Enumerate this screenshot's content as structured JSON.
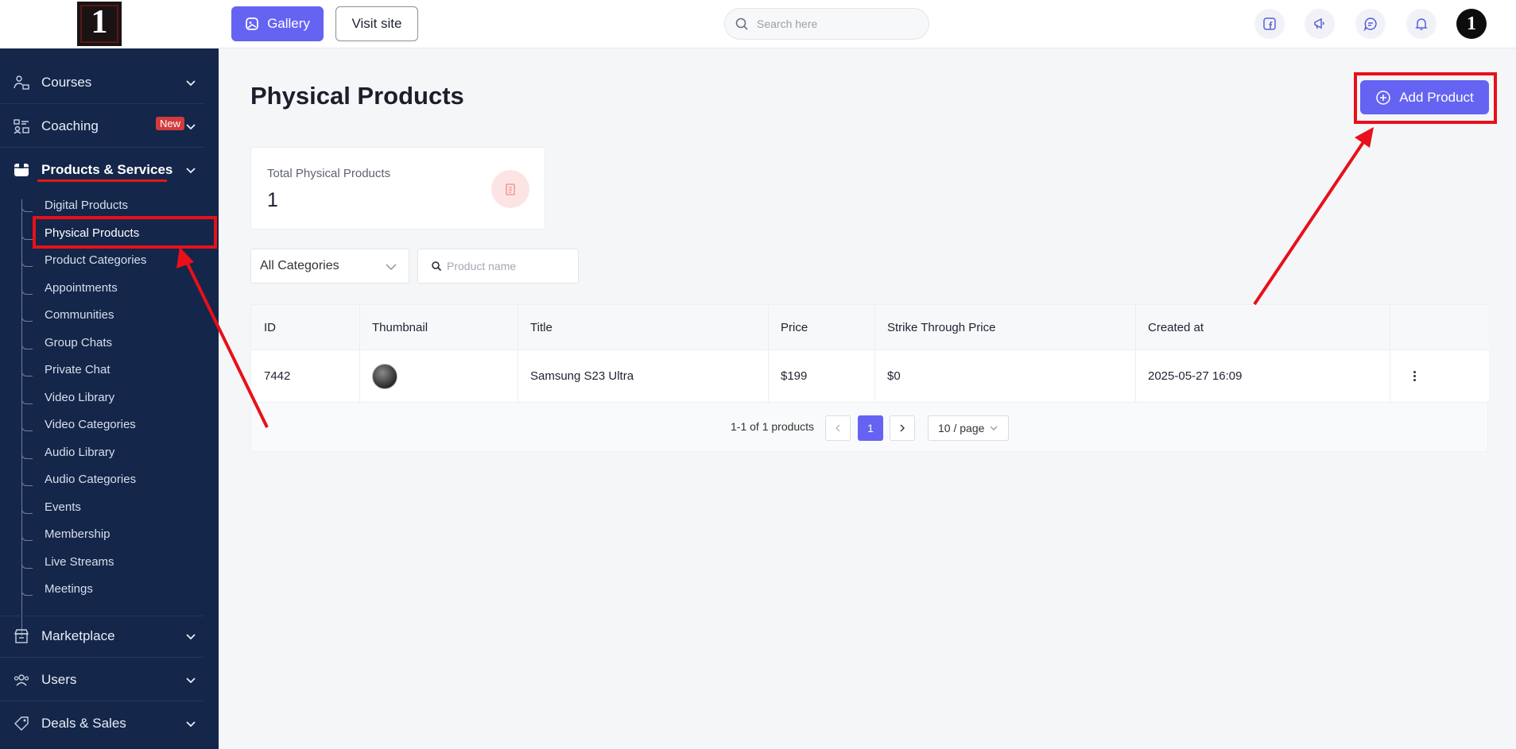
{
  "header": {
    "logo_text": "1",
    "gallery_label": "Gallery",
    "visit_label": "Visit site",
    "search_placeholder": "Search here",
    "avatar_text": "1"
  },
  "sidebar": {
    "main_items": [
      {
        "label": "Courses",
        "icon": "courses-icon"
      },
      {
        "label": "Coaching",
        "icon": "coaching-icon",
        "badge": "New"
      },
      {
        "label": "Products & Services",
        "icon": "box-icon"
      },
      {
        "label": "Marketplace",
        "icon": "store-icon"
      },
      {
        "label": "Users",
        "icon": "users-icon"
      },
      {
        "label": "Deals & Sales",
        "icon": "tag-icon"
      }
    ],
    "sub_items": [
      "Digital Products",
      "Physical Products",
      "Product Categories",
      "Appointments",
      "Communities",
      "Group Chats",
      "Private Chat",
      "Video Library",
      "Video Categories",
      "Audio Library",
      "Audio Categories",
      "Events",
      "Membership",
      "Live Streams",
      "Meetings"
    ]
  },
  "main": {
    "title": "Physical Products",
    "add_label": "Add Product",
    "stat": {
      "label": "Total Physical Products",
      "value": "1"
    },
    "category_select": "All Categories",
    "product_search_placeholder": "Product name",
    "table": {
      "columns": [
        "ID",
        "Thumbnail",
        "Title",
        "Price",
        "Strike Through Price",
        "Created at"
      ],
      "rows": [
        {
          "id": "7442",
          "title": "Samsung S23 Ultra",
          "price": "$199",
          "strike_price": "$0",
          "created_at": "2025-05-27 16:09"
        }
      ]
    },
    "pagination": {
      "info": "1-1 of 1 products",
      "current_page": "1",
      "page_size": "10 / page"
    }
  },
  "colors": {
    "accent": "#6563f2",
    "sidebar_bg": "#14264a",
    "annotation_red": "#e8101a"
  }
}
